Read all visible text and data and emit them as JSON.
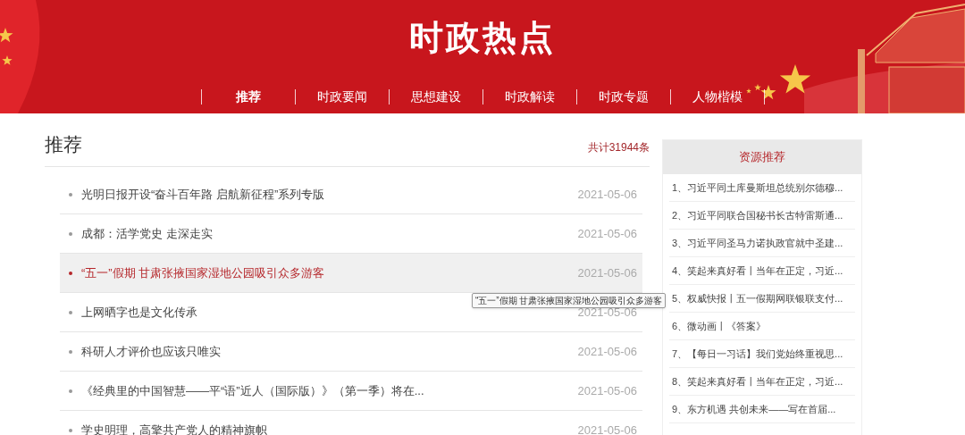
{
  "header": {
    "title": "时政热点",
    "nav": [
      {
        "label": "推荐",
        "selected": true
      },
      {
        "label": "时政要闻",
        "selected": false
      },
      {
        "label": "思想建设",
        "selected": false
      },
      {
        "label": "时政解读",
        "selected": false
      },
      {
        "label": "时政专题",
        "selected": false
      },
      {
        "label": "人物楷模",
        "selected": false
      }
    ]
  },
  "list": {
    "title": "推荐",
    "count": "共计31944条",
    "items": [
      {
        "title": "光明日报开设“奋斗百年路 启航新征程”系列专版",
        "date": "2021-05-06",
        "selected": false
      },
      {
        "title": "成都：活学党史 走深走实",
        "date": "2021-05-06",
        "selected": false
      },
      {
        "title": "“五一”假期 甘肃张掖国家湿地公园吸引众多游客",
        "date": "2021-05-06",
        "selected": true
      },
      {
        "title": "上网晒字也是文化传承",
        "date": "2021-05-06",
        "selected": false
      },
      {
        "title": "科研人才评价也应该只唯实",
        "date": "2021-05-06",
        "selected": false
      },
      {
        "title": "《经典里的中国智慧——平“语”近人（国际版）》（第一季）将在...",
        "date": "2021-05-06",
        "selected": false
      },
      {
        "title": "学史明理，高擎共产党人的精神旗帜",
        "date": "2021-05-06",
        "selected": false
      }
    ]
  },
  "tooltip": "“五一”假期 甘肃张掖国家湿地公园吸引众多游客",
  "sidebar": {
    "title": "资源推荐",
    "items": [
      "1、习近平同土库曼斯坦总统别尔德穆...",
      "2、习近平同联合国秘书长古特雷斯通...",
      "3、习近平同圣马力诺执政官就中圣建...",
      "4、笑起来真好看丨当年在正定，习近...",
      "5、权威快报丨五一假期网联银联支付...",
      "6、微动画丨《答案》",
      "7、【每日一习话】我们党始终重视思...",
      "8、笑起来真好看丨当年在正定，习近...",
      "9、东方机遇 共创未来——写在首届..."
    ]
  }
}
